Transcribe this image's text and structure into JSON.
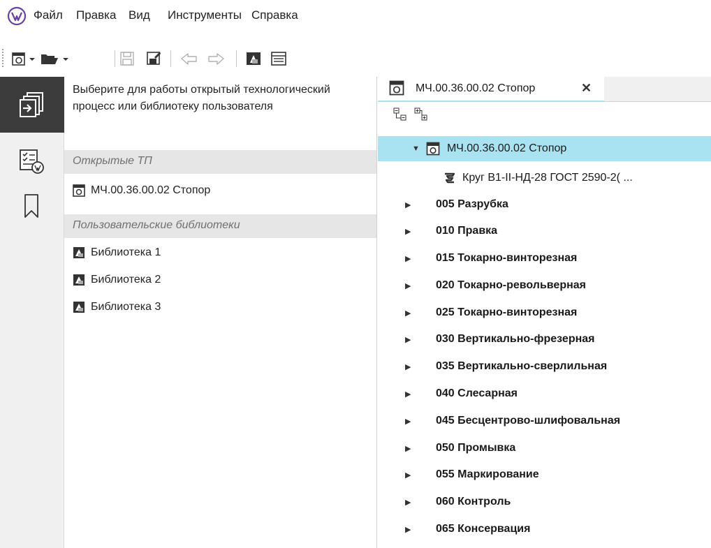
{
  "menu": {
    "items": [
      "Файл",
      "Правка",
      "Вид",
      "Инструменты",
      "Справка"
    ]
  },
  "toolbar": {
    "buttons": [
      "new-process-icon",
      "open-folder-icon",
      "save-icon",
      "save-as-icon",
      "undo-icon",
      "redo-icon",
      "library-icon",
      "properties-icon"
    ]
  },
  "sidebar": {
    "items": [
      "open-panel-icon",
      "checklist-icon",
      "bookmark-icon"
    ]
  },
  "left_panel": {
    "intro": "Выберите для работы открытый технологический процесс или библиотеку пользователя",
    "open_tp_header": "Открытые ТП",
    "open_tp_items": [
      "МЧ.00.36.00.02 Стопор"
    ],
    "libraries_header": "Пользовательские библиотеки",
    "libraries": [
      "Библиотека 1",
      "Библиотека 2",
      "Библиотека 3"
    ]
  },
  "right_panel": {
    "tab_label": "МЧ.00.36.00.02 Стопор",
    "tab_close": "✕",
    "tree": {
      "root": "МЧ.00.36.00.02 Стопор",
      "material": "Круг В1-II-НД-28 ГОСТ 2590-2(  ...",
      "operations": [
        "005 Разрубка",
        "010 Правка",
        "015 Токарно-винторезная",
        "020 Токарно-револьверная",
        "025 Токарно-винторезная",
        "030 Вертикально-фрезерная",
        "035 Вертикально-сверлильная",
        "040 Слесарная",
        "045 Бесцентрово-шлифовальная",
        "050 Промывка",
        "055 Маркирование",
        "060 Контроль",
        "065 Консервация"
      ]
    }
  },
  "colors": {
    "selection": "#a9e3f2",
    "sidebar_active": "#3c3c3c",
    "section_header": "#e6e6e6"
  }
}
